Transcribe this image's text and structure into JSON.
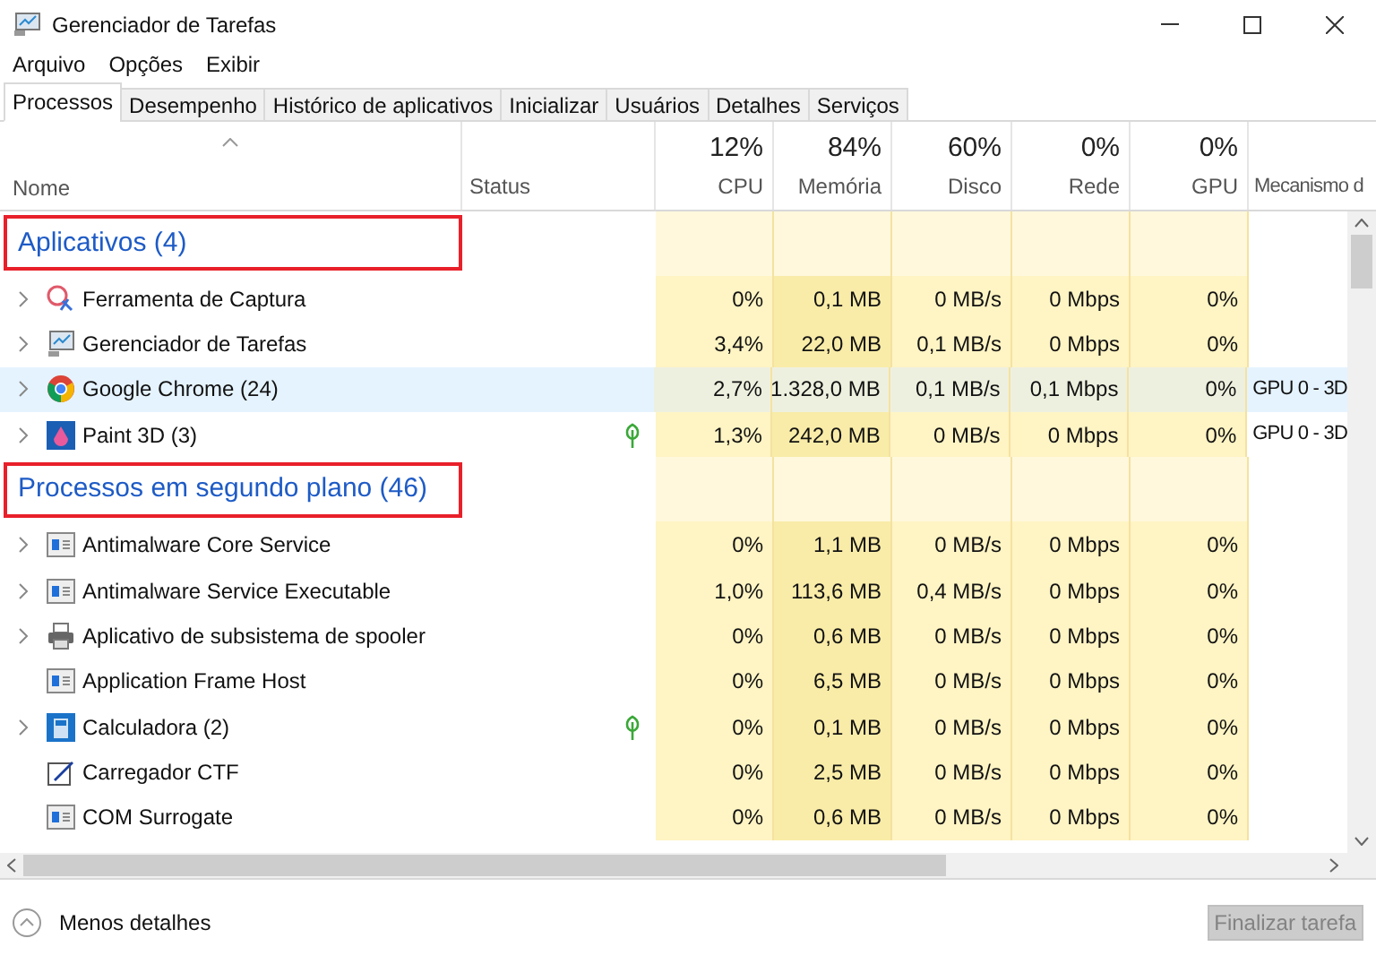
{
  "window": {
    "title": "Gerenciador de Tarefas"
  },
  "menu": [
    "Arquivo",
    "Opções",
    "Exibir"
  ],
  "tabs": [
    {
      "label": "Processos",
      "selected": true
    },
    {
      "label": "Desempenho",
      "selected": false
    },
    {
      "label": "Histórico de aplicativos",
      "selected": false
    },
    {
      "label": "Inicializar",
      "selected": false
    },
    {
      "label": "Usuários",
      "selected": false
    },
    {
      "label": "Detalhes",
      "selected": false
    },
    {
      "label": "Serviços",
      "selected": false
    }
  ],
  "columns": [
    {
      "label": "Nome"
    },
    {
      "label": "Status"
    },
    {
      "label": "CPU",
      "usage": "12%"
    },
    {
      "label": "Memória",
      "usage": "84%"
    },
    {
      "label": "Disco",
      "usage": "60%"
    },
    {
      "label": "Rede",
      "usage": "0%"
    },
    {
      "label": "GPU",
      "usage": "0%"
    },
    {
      "label": "Mecanismo d"
    }
  ],
  "groups": [
    {
      "title": "Aplicativos (4)",
      "highlighted": true,
      "rows": [
        {
          "name": "Ferramenta de Captura",
          "kind": "snip",
          "expandable": true,
          "selected": false,
          "efficiency": false,
          "cells": [
            "0%",
            "0,1 MB",
            "0 MB/s",
            "0 Mbps",
            "0%"
          ]
        },
        {
          "name": "Gerenciador de Tarefas",
          "kind": "monitor",
          "expandable": true,
          "selected": false,
          "efficiency": false,
          "cells": [
            "3,4%",
            "22,0 MB",
            "0,1 MB/s",
            "0 Mbps",
            "0%"
          ]
        },
        {
          "name": "Google Chrome (24)",
          "kind": "browser",
          "expandable": true,
          "selected": true,
          "efficiency": false,
          "cells": [
            "2,7%",
            "1.328,0 MB",
            "0,1 MB/s",
            "0,1 Mbps",
            "0%"
          ],
          "engine": "GPU 0 - 3D"
        },
        {
          "name": "Paint 3D (3)",
          "kind": "paint",
          "expandable": true,
          "selected": false,
          "efficiency": true,
          "cells": [
            "1,3%",
            "242,0 MB",
            "0 MB/s",
            "0 Mbps",
            "0%"
          ],
          "engine": "GPU 0 - 3D"
        }
      ]
    },
    {
      "title": "Processos em segundo plano (46)",
      "highlighted": true,
      "rows": [
        {
          "name": "Antimalware Core Service",
          "kind": "service",
          "expandable": true,
          "selected": false,
          "efficiency": false,
          "cells": [
            "0%",
            "1,1 MB",
            "0 MB/s",
            "0 Mbps",
            "0%"
          ]
        },
        {
          "name": "Antimalware Service Executable",
          "kind": "service",
          "expandable": true,
          "selected": false,
          "efficiency": false,
          "cells": [
            "1,0%",
            "113,6 MB",
            "0,4 MB/s",
            "0 Mbps",
            "0%"
          ]
        },
        {
          "name": "Aplicativo de subsistema de spooler",
          "kind": "printer",
          "expandable": true,
          "selected": false,
          "efficiency": false,
          "cells": [
            "0%",
            "0,6 MB",
            "0 MB/s",
            "0 Mbps",
            "0%"
          ]
        },
        {
          "name": "Application Frame Host",
          "kind": "service",
          "expandable": false,
          "selected": false,
          "efficiency": false,
          "cells": [
            "0%",
            "6,5 MB",
            "0 MB/s",
            "0 Mbps",
            "0%"
          ]
        },
        {
          "name": "Calculadora (2)",
          "kind": "calculator",
          "expandable": true,
          "selected": false,
          "efficiency": true,
          "cells": [
            "0%",
            "0,1 MB",
            "0 MB/s",
            "0 Mbps",
            "0%"
          ]
        },
        {
          "name": "Carregador CTF",
          "kind": "pen",
          "expandable": false,
          "selected": false,
          "efficiency": false,
          "cells": [
            "0%",
            "2,5 MB",
            "0 MB/s",
            "0 Mbps",
            "0%"
          ]
        },
        {
          "name": "COM Surrogate",
          "kind": "service",
          "expandable": false,
          "selected": false,
          "efficiency": false,
          "cells": [
            "0%",
            "0,6 MB",
            "0 MB/s",
            "0 Mbps",
            "0%"
          ]
        }
      ]
    }
  ],
  "footer": {
    "toggle": "Menos detalhes",
    "end_task": {
      "label": "Finalizar tarefa",
      "disabled": true
    }
  }
}
